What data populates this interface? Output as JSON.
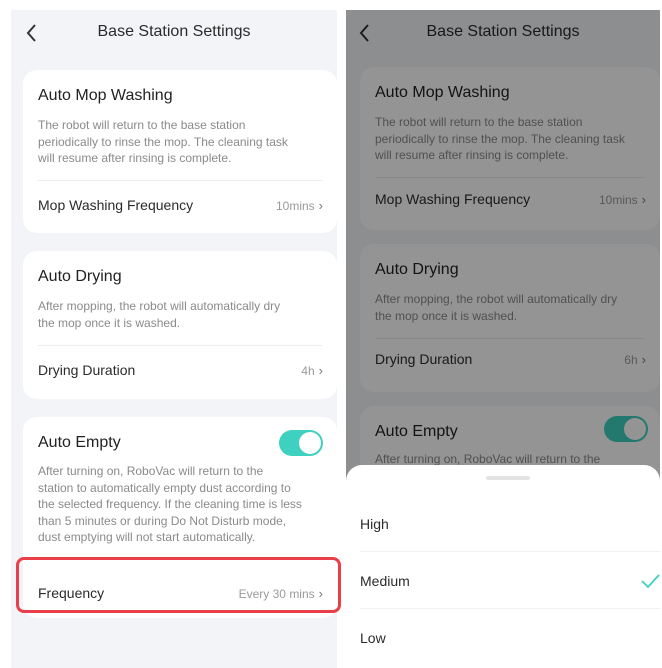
{
  "left_screen": {
    "title": "Base Station Settings",
    "auto_mop": {
      "title": "Auto Mop Washing",
      "description_lines": [
        "The robot will return to the base station",
        "periodically to rinse the mop. The cleaning task",
        "will resume after rinsing is complete."
      ],
      "frequency_label": "Mop Washing Frequency",
      "frequency_value": "10mins"
    },
    "auto_drying": {
      "title": "Auto Drying",
      "description_lines": [
        "After mopping, the robot will automatically dry",
        "the mop once it is washed."
      ],
      "duration_label": "Drying Duration",
      "duration_value": "4h"
    },
    "auto_empty": {
      "title": "Auto Empty",
      "toggle_on": true,
      "description_lines": [
        "After turning on, RoboVac will return to the",
        "station to automatically empty dust according to",
        "the selected frequency. If the cleaning time is less",
        "than 5 minutes or during Do Not Disturb mode,",
        "dust emptying will not start automatically."
      ],
      "frequency_label": "Frequency",
      "frequency_value": "Every 30 mins"
    }
  },
  "right_screen": {
    "title": "Base Station Settings",
    "auto_mop": {
      "title": "Auto Mop Washing",
      "description_lines": [
        "The robot will return to the base station",
        "periodically to rinse the mop. The cleaning task",
        "will resume after rinsing is complete."
      ],
      "frequency_label": "Mop Washing Frequency",
      "frequency_value": "10mins"
    },
    "auto_drying": {
      "title": "Auto Drying",
      "description_lines": [
        "After mopping, the robot will automatically dry",
        "the mop once it is washed."
      ],
      "duration_label": "Drying Duration",
      "duration_value": "6h"
    },
    "auto_empty": {
      "title": "Auto Empty",
      "toggle_on": true,
      "description_partial": "After turning on, RoboVac will return to the"
    },
    "sheet_options": [
      {
        "label": "High",
        "selected": false
      },
      {
        "label": "Medium",
        "selected": true
      },
      {
        "label": "Low",
        "selected": false
      }
    ]
  },
  "colors": {
    "accent": "#3fd1c0",
    "highlight": "#ea3f4a",
    "background": "#f3f4f7"
  },
  "icons": {
    "back": "chevron-left-icon",
    "chevron": "chevron-right-icon",
    "check": "check-icon"
  }
}
